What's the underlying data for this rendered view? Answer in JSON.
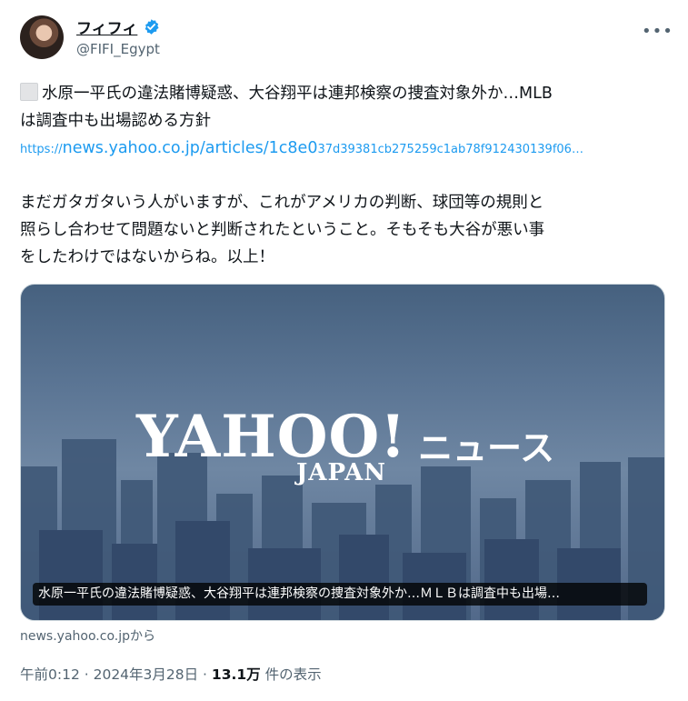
{
  "author": {
    "name": "フィフィ",
    "handle": "@FIFI_Egypt",
    "verified_color": "#1d9bf0"
  },
  "tweet": {
    "line1": "水原一平氏の違法賭博疑惑、大谷翔平は連邦検察の捜査対象外か…MLB",
    "line2": "は調査中も出場認める方針",
    "link_prefix": "https://",
    "link_main": "news.yahoo.co.jp/articles/1c8e0",
    "link_rest": "37d39381cb275259c1ab78f912430139f06…",
    "body1": "まだガタガタいう人がいますが、これがアメリカの判断、球団等の規則と",
    "body2": "照らし合わせて問題ないと判断されたということ。そもそも大谷が悪い事",
    "body3": "をしたわけではないからね。以上！"
  },
  "card": {
    "logo_main": "YAHOO!",
    "logo_sub": "JAPAN",
    "logo_news": "ニュース",
    "caption": "水原一平氏の違法賭博疑惑、大谷翔平は連邦検察の捜査対象外か…ＭＬＢは調査中も出場…",
    "source": "news.yahoo.co.jpから"
  },
  "meta": {
    "time": "午前0:12",
    "sep1": " · ",
    "date": "2024年3月28日",
    "sep2": " · ",
    "views": "13.1万",
    "views_label": " 件の表示"
  },
  "icons": {
    "more": "more-dots-icon",
    "verified": "verified-badge-icon",
    "emoji": "newspaper-emoji-icon"
  }
}
